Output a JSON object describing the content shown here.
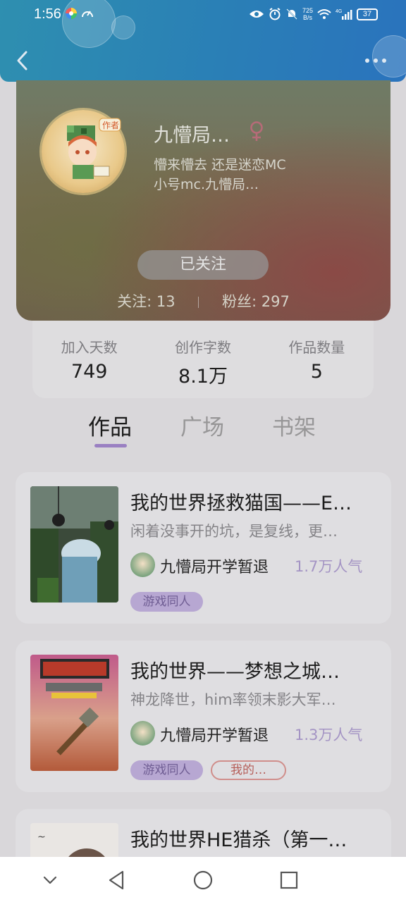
{
  "status_bar": {
    "time": "1:56",
    "net_speed_value": "725",
    "net_speed_unit": "B/s",
    "network": "4G",
    "battery": "37"
  },
  "nav": {
    "back_icon": "chevron-left-icon",
    "more_icon": "more-horizontal-icon"
  },
  "profile": {
    "name": "九懵局…",
    "gender_icon": "female-icon",
    "bio_line1": "懵来懵去 还是迷恋MC",
    "bio_line2": "小号mc.九懵局…",
    "follow_button": "已关注",
    "following_label": "关注:",
    "following_count": "13",
    "fans_label": "粉丝:",
    "fans_count": "297"
  },
  "stats": [
    {
      "label": "加入天数",
      "value": "749"
    },
    {
      "label": "创作字数",
      "value": "8.1万"
    },
    {
      "label": "作品数量",
      "value": "5"
    }
  ],
  "tabs": [
    {
      "label": "作品",
      "active": true
    },
    {
      "label": "广场",
      "active": false
    },
    {
      "label": "书架",
      "active": false
    }
  ],
  "works": [
    {
      "title": "我的世界拯救猫国——E…",
      "desc": "闲着没事开的坑，是复线，更…",
      "author": "九懵局开学暂退",
      "popularity": "1.7万人气",
      "tags": [
        "游戏同人"
      ]
    },
    {
      "title": "我的世界——梦想之城…",
      "desc": "神龙降世，him率领末影大军…",
      "author": "九懵局开学暂退",
      "popularity": "1.3万人气",
      "tags": [
        "游戏同人",
        "我的…"
      ]
    },
    {
      "title": "我的世界HE猎杀（第一…"
    }
  ],
  "system_nav": {
    "collapse_icon": "chevron-down-icon",
    "back_icon": "triangle-back-icon",
    "home_icon": "circle-home-icon",
    "recents_icon": "square-recents-icon"
  }
}
